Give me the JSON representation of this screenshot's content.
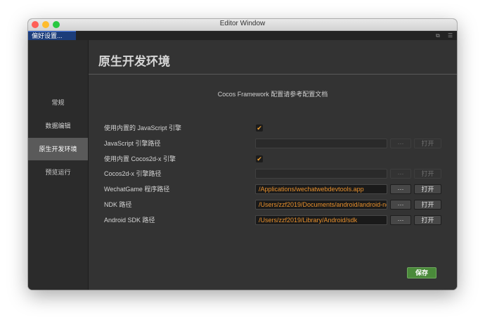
{
  "window": {
    "title": "Editor Window"
  },
  "tab": {
    "label": "偏好设置..."
  },
  "tab_icons": [
    "popout-icon",
    "menu-icon"
  ],
  "sidebar": {
    "items": [
      {
        "label": "常规",
        "active": false
      },
      {
        "label": "数据编辑",
        "active": false
      },
      {
        "label": "原生开发环境",
        "active": true
      },
      {
        "label": "预览运行",
        "active": false
      }
    ]
  },
  "main": {
    "title": "原生开发环境",
    "info": "Cocos Framework 配置请参考配置文档",
    "rows": {
      "builtin_js": {
        "label": "使用内置的 JavaScript 引擎",
        "checked": true,
        "check_glyph": "✔"
      },
      "js_path": {
        "label": "JavaScript 引擎路径",
        "value": ""
      },
      "builtin_cocos": {
        "label": "使用内置 Cocos2d-x 引擎",
        "checked": true,
        "check_glyph": "✔"
      },
      "cocos_path": {
        "label": "Cocos2d-x 引擎路径",
        "value": ""
      },
      "wechat_path": {
        "label": "WechatGame 程序路径",
        "value": "/Applications/wechatwebdevtools.app"
      },
      "ndk_path": {
        "label": "NDK 路径",
        "value": "/Users/zzf2019/Documents/android/android-nd"
      },
      "sdk_path": {
        "label": "Android SDK 路径",
        "value": "/Users/zzf2019/Library/Android/sdk"
      }
    },
    "browse_label": "···",
    "open_label": "打开",
    "save_label": "保存"
  },
  "colors": {
    "accent_path_text": "#e8902c",
    "save_button": "#4a8a3a",
    "tab_active": "#1c3d7a",
    "sidebar_active": "#5a5a5a"
  }
}
